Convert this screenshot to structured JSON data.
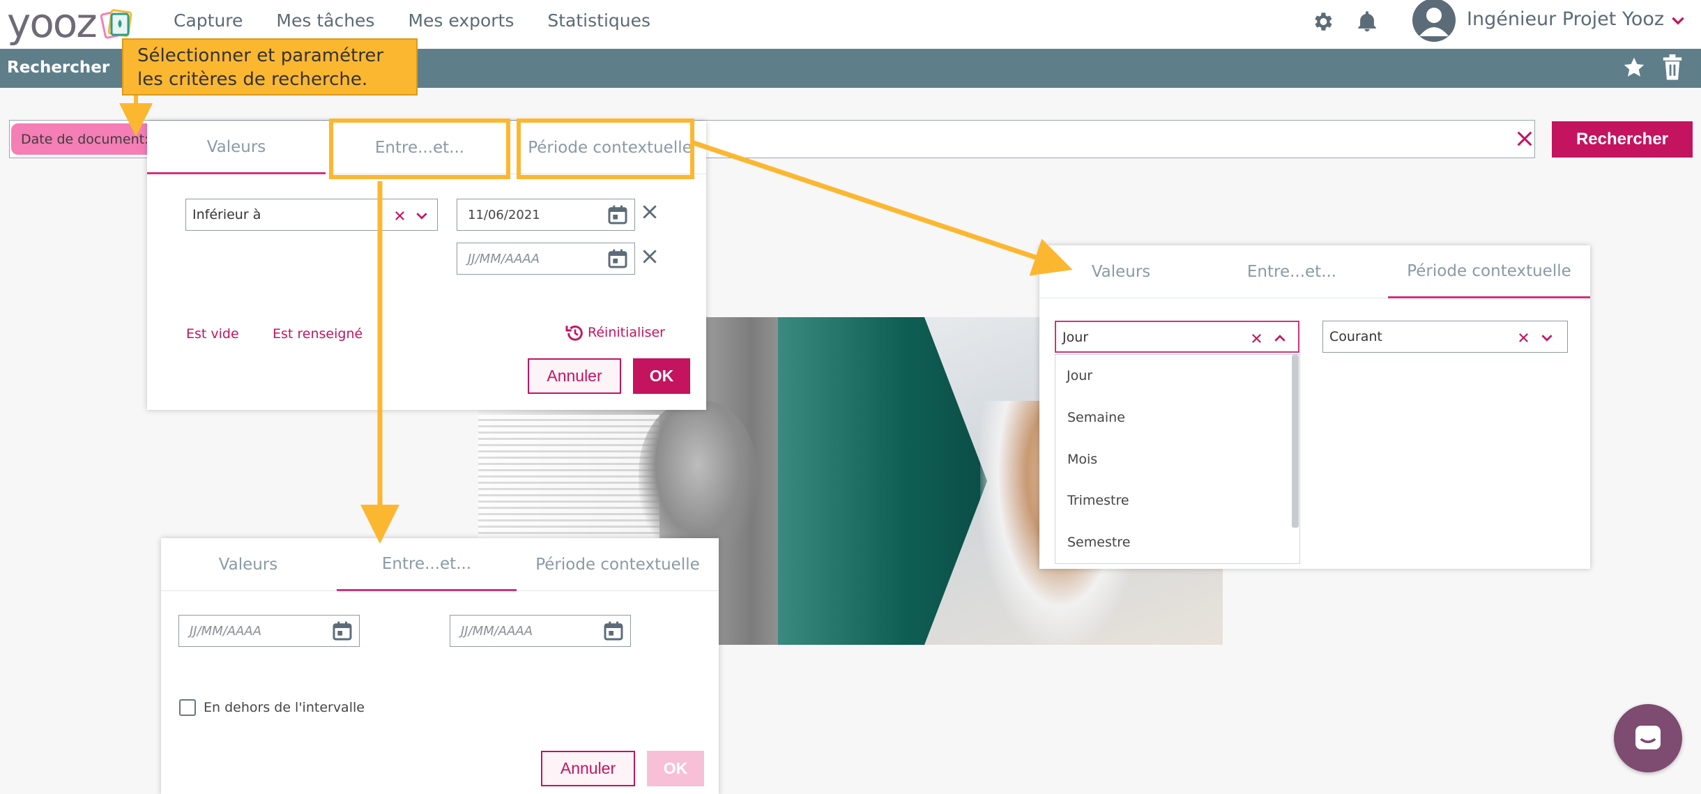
{
  "app": {
    "logo_text": "yooz",
    "nav": [
      "Capture",
      "Mes tâches",
      "Mes exports",
      "Statistiques"
    ],
    "user_name": "Ingénieur Projet Yooz",
    "icons": [
      "gear-icon",
      "bell-icon",
      "user-avatar-icon",
      "chevron-down-icon"
    ]
  },
  "searchbar": {
    "title": "Rechercher",
    "icons": [
      "star-icon",
      "trash-icon"
    ]
  },
  "criteria": {
    "tag_label": "Date de document:",
    "search_button": "Rechercher"
  },
  "annotation": {
    "callout_text": "Sélectionner et paramétrer les critères de recherche."
  },
  "tabs": {
    "values": "Valeurs",
    "between": "Entre...et...",
    "contextual": "Période contextuelle"
  },
  "values_panel": {
    "operator": "Inférieur à",
    "date1": "11/06/2021",
    "date2_placeholder": "JJ/MM/AAAA",
    "is_empty": "Est vide",
    "is_filled": "Est renseigné",
    "reset": "Réinitialiser",
    "cancel": "Annuler",
    "ok": "OK"
  },
  "contextual_panel": {
    "period_value": "Jour",
    "relative_value": "Courant",
    "period_options": [
      "Jour",
      "Semaine",
      "Mois",
      "Trimestre",
      "Semestre"
    ]
  },
  "between_panel": {
    "from_placeholder": "JJ/MM/AAAA",
    "to_placeholder": "JJ/MM/AAAA",
    "outside_label": "En dehors de l'intervalle",
    "cancel": "Annuler",
    "ok": "OK"
  },
  "colors": {
    "accent": "#c4135f",
    "tag": "#f47eb5",
    "header_bar": "#5e7f8a",
    "annotation": "#fcb731",
    "chat": "#7e4b71"
  }
}
